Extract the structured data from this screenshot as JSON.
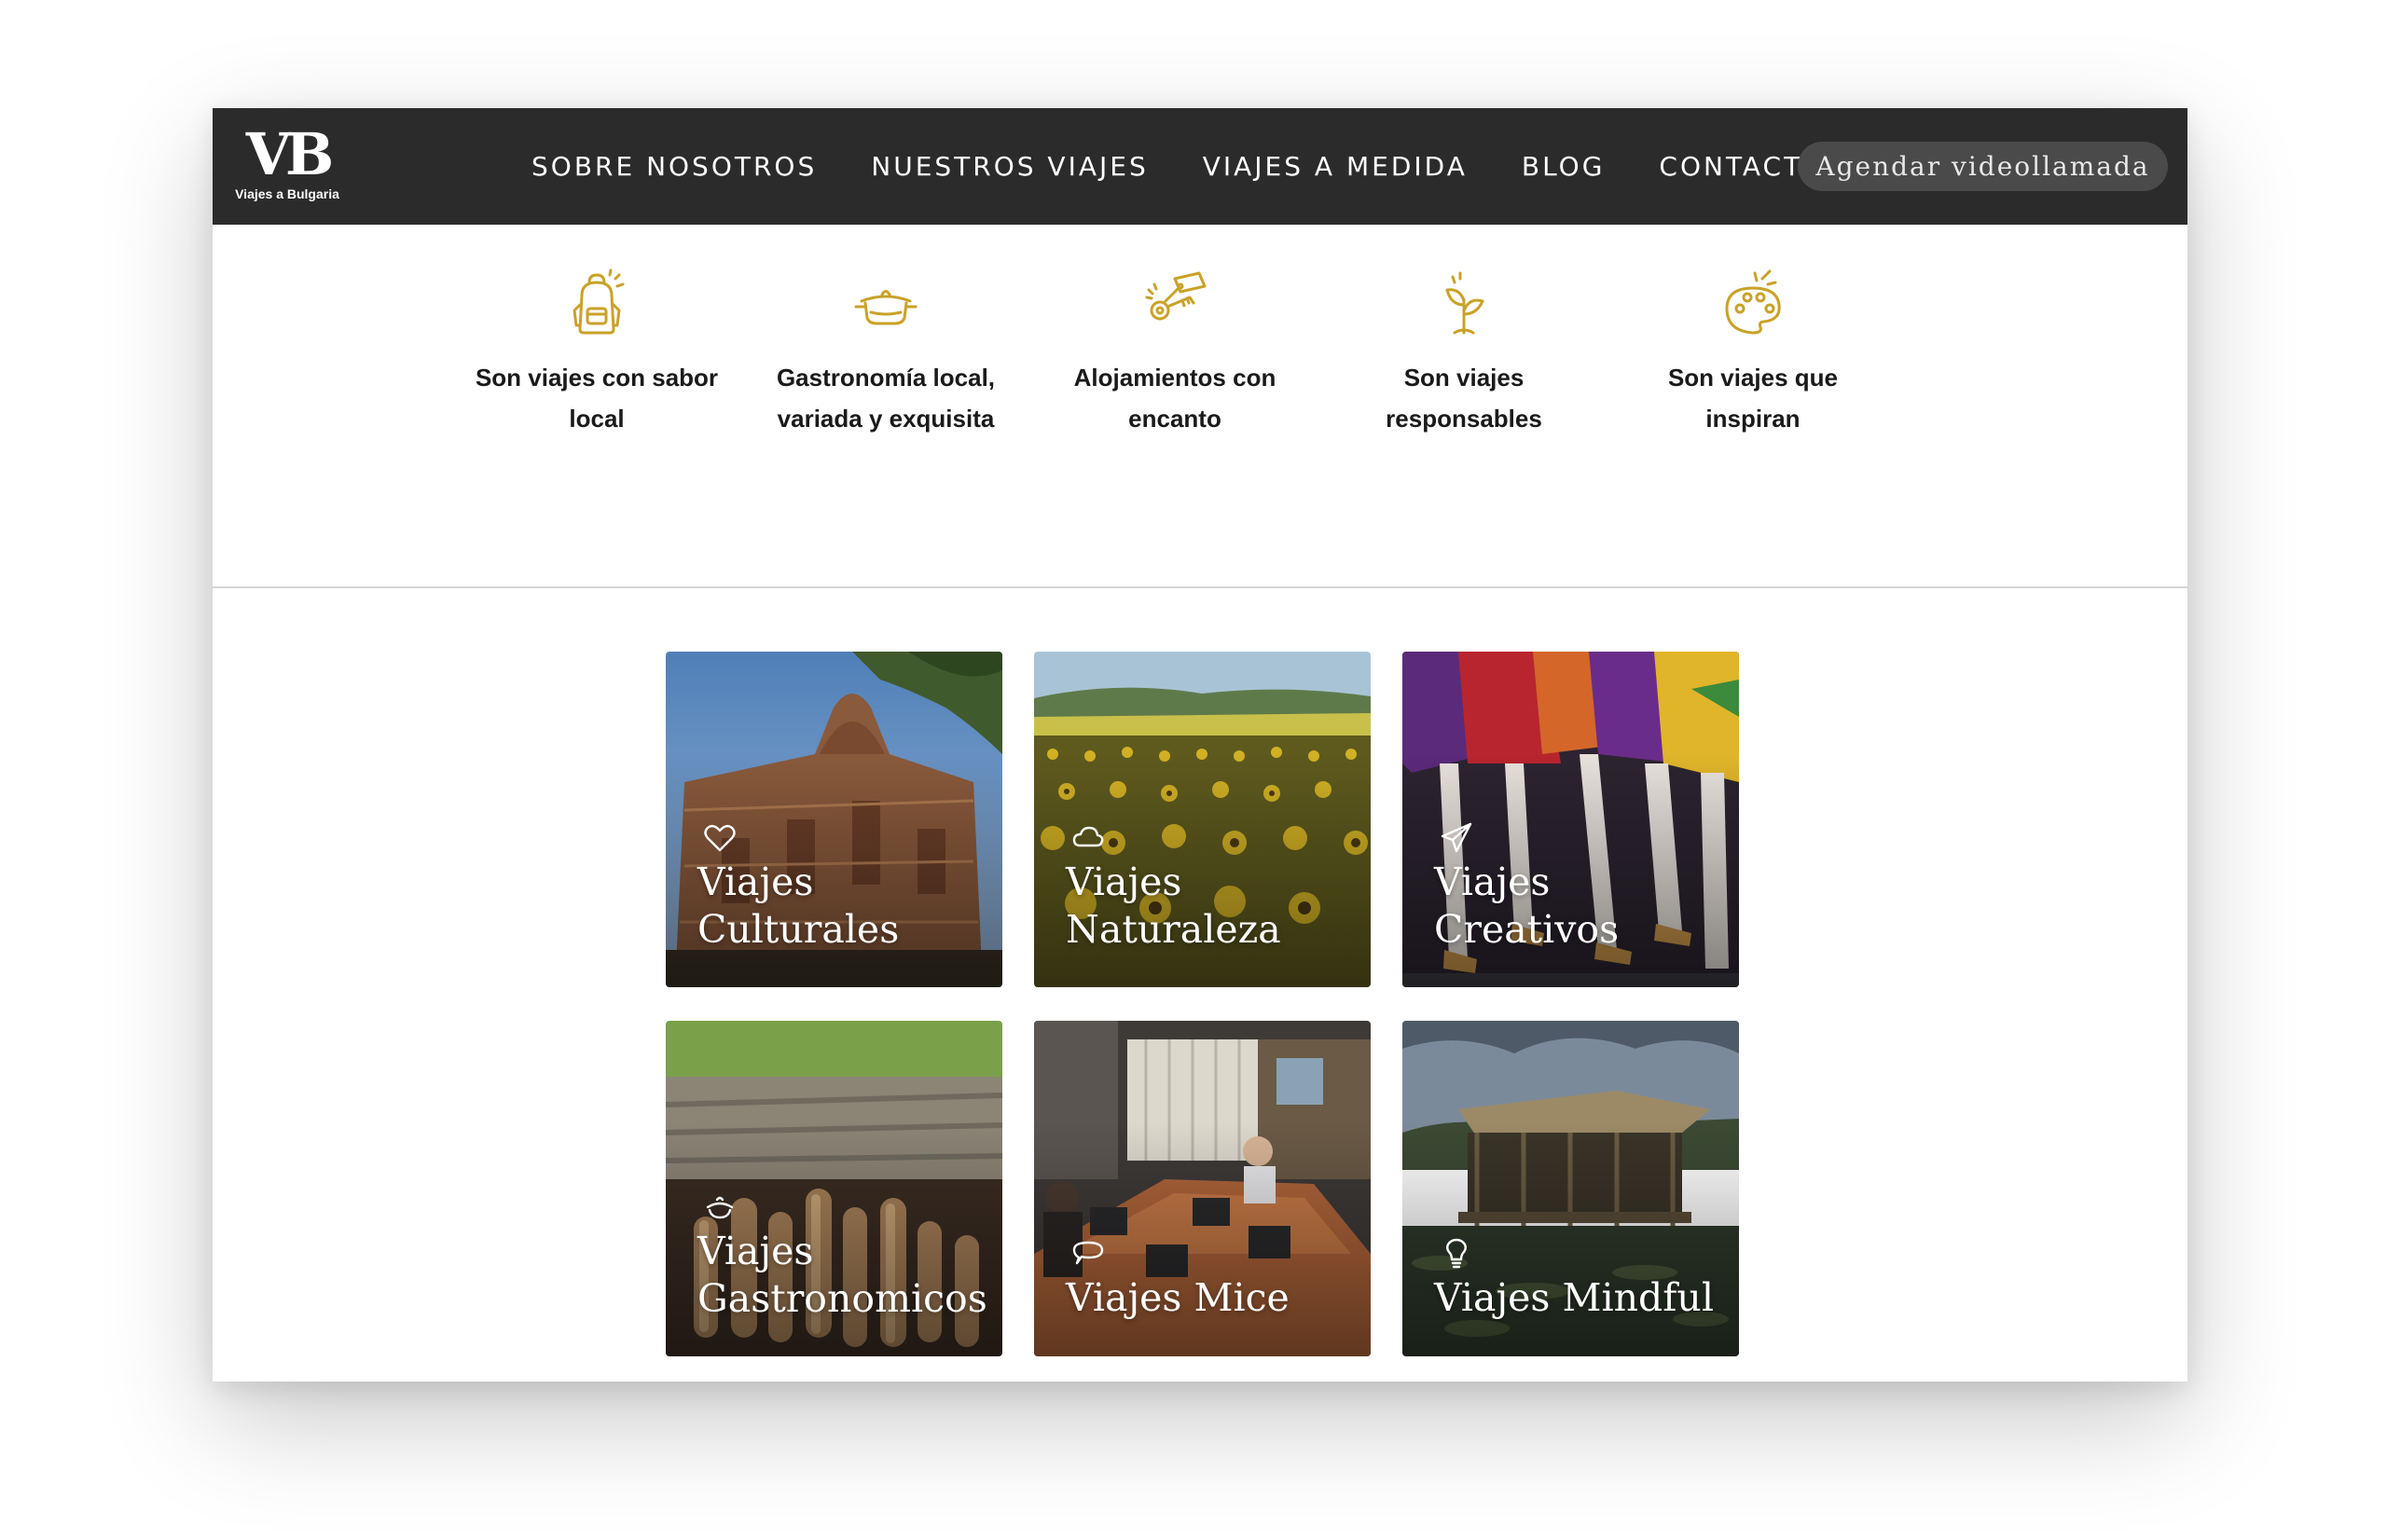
{
  "header": {
    "logo_mark": "VB",
    "logo_sub": "Viajes a Bulgaria",
    "nav": [
      {
        "label": "SOBRE NOSOTROS"
      },
      {
        "label": "NUESTROS VIAJES"
      },
      {
        "label": "VIAJES A MEDIDA"
      },
      {
        "label": "BLOG"
      },
      {
        "label": "CONTACTO"
      }
    ],
    "cta_label": "Agendar videollamada"
  },
  "features": [
    {
      "icon": "backpack-icon",
      "label": "Son viajes con sabor\nlocal"
    },
    {
      "icon": "cooking-pot-icon",
      "label": "Gastronomía local,\nvariada y exquisita"
    },
    {
      "icon": "key-tag-icon",
      "label": "Alojamientos con\nencanto"
    },
    {
      "icon": "sprout-icon",
      "label": "Son viajes\nresponsables"
    },
    {
      "icon": "palette-icon",
      "label": "Son viajes que\ninspiran"
    }
  ],
  "categories": [
    {
      "icon": "heart-icon",
      "title": "Viajes\nCulturales"
    },
    {
      "icon": "cloud-icon",
      "title": "Viajes\nNaturaleza"
    },
    {
      "icon": "paper-plane-icon",
      "title": "Viajes\nCreativos"
    },
    {
      "icon": "dish-icon",
      "title": "Viajes\nGastronomicos"
    },
    {
      "icon": "speech-bubble-icon",
      "title": "Viajes Mice"
    },
    {
      "icon": "lightbulb-icon",
      "title": "Viajes Mindful"
    }
  ],
  "colors": {
    "header_bg": "#2b2b2b",
    "accent_gold": "#c9a227",
    "cta_bg": "#4a4a4a"
  }
}
